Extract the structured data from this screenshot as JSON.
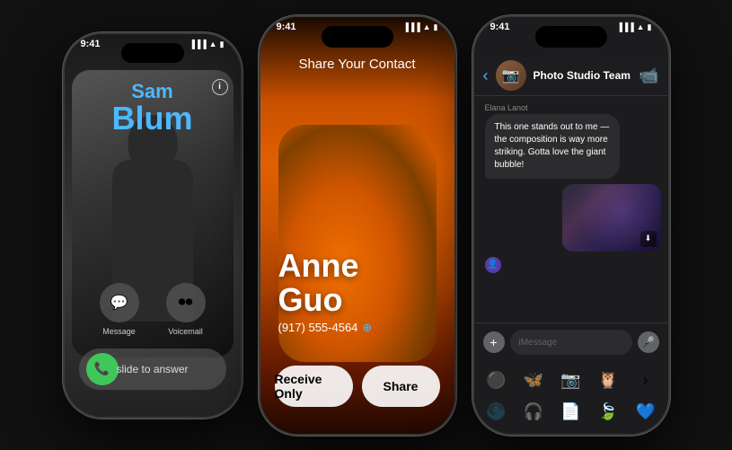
{
  "phone1": {
    "status_time": "9:41",
    "caller_first": "Sam",
    "caller_last": "Blum",
    "action_message": "Message",
    "action_voicemail": "Voicemail",
    "slide_to_answer": "slide to answer"
  },
  "phone2": {
    "status_time": "9:41",
    "share_title": "Share Your Contact",
    "contact_first": "Anne",
    "contact_last": "Guo",
    "contact_phone": "(917) 555-4564",
    "btn_receive": "Receive Only",
    "btn_share": "Share"
  },
  "phone3": {
    "status_time": "9:41",
    "group_name": "Photo Studio Team",
    "sender": "Elana Lanot",
    "message1": "This one stands out to me — the composition is way more striking. Gotta love the giant bubble!",
    "imessage_placeholder": "iMessage"
  }
}
